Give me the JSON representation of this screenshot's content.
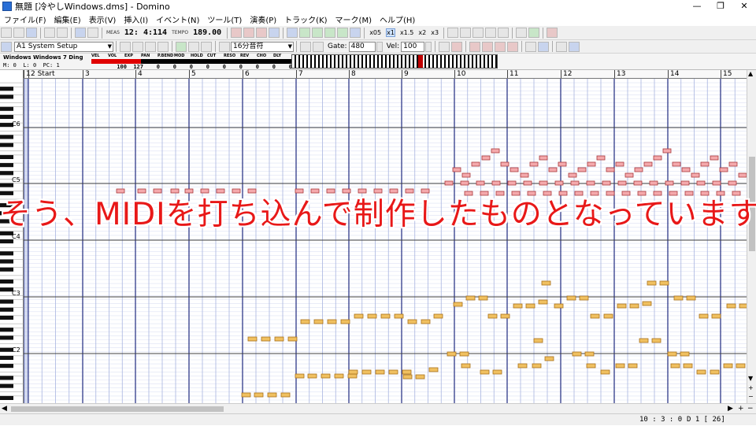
{
  "window": {
    "title": "無題 [冷やしWindows.dms] - Domino",
    "minimize": "—",
    "maximize": "❐",
    "close": "✕"
  },
  "menu": [
    "ファイル(F)",
    "編集(E)",
    "表示(V)",
    "挿入(I)",
    "イベント(N)",
    "ツール(T)",
    "演奏(P)",
    "トラック(K)",
    "マーク(M)",
    "ヘルプ(H)"
  ],
  "toolbar": {
    "meas_label": "MEAS",
    "position": "12: 4:114",
    "tempo_label": "TEMPO",
    "tempo": "189.00",
    "zooms": [
      "x05",
      "x1",
      "x1.5",
      "x2",
      "x3"
    ]
  },
  "toolbar2": {
    "event_select": "A1 System Setup",
    "note_length": "16分音符",
    "gate_label": "Gate:",
    "gate_value": "480",
    "vel_label": "Vel:",
    "vel_value": "100"
  },
  "control_panel": {
    "track_name": "Windows Windows 7 Ding",
    "mi_label": "M:",
    "mi_value": "0",
    "l_label": "L:",
    "l_value": "0",
    "pc_label": "PC:",
    "pc_value": "1",
    "controllers": [
      {
        "name": "VEL",
        "value": "",
        "color": "#e00000"
      },
      {
        "name": "VOL",
        "value": "100",
        "color": "#e00000"
      },
      {
        "name": "EXP",
        "value": "127",
        "color": "#e00000"
      },
      {
        "name": "PAN",
        "value": "0",
        "color": "#000000"
      },
      {
        "name": "P.BEND",
        "value": "0",
        "color": "#000000"
      },
      {
        "name": "MOD",
        "value": "0",
        "color": "#000000"
      },
      {
        "name": "HOLD",
        "value": "0",
        "color": "#000000"
      },
      {
        "name": "CUT",
        "value": "0",
        "color": "#000000"
      },
      {
        "name": "RESO",
        "value": "0",
        "color": "#000000"
      },
      {
        "name": "REV",
        "value": "0",
        "color": "#000000"
      },
      {
        "name": "CHO",
        "value": "0",
        "color": "#000000"
      },
      {
        "name": "DLY",
        "value": "0",
        "color": "#000000"
      }
    ]
  },
  "ruler": {
    "marks": [
      "1",
      "2 Start",
      "3",
      "4",
      "5",
      "6",
      "7",
      "8",
      "9",
      "10",
      "11",
      "12",
      "13",
      "14",
      "15"
    ]
  },
  "piano_roll": {
    "octave_labels": [
      "C6",
      "C5",
      "C4",
      "C3",
      "C2"
    ],
    "colors": {
      "upper_note": "#f4a9ac",
      "upper_note_border": "#a8383c",
      "lower_note": "#f0c060",
      "lower_note_border": "#a8701c",
      "measure_line": "#1f2a80",
      "beat_line": "#a8b4e0",
      "row_line": "#dde2f4",
      "octave_line": "#404040"
    }
  },
  "statusbar": {
    "position": "10 : 3 : 0",
    "track": "D 1 [ 26]"
  },
  "caption": "そう、MIDIを打ち込んで制作したものとなっています。"
}
